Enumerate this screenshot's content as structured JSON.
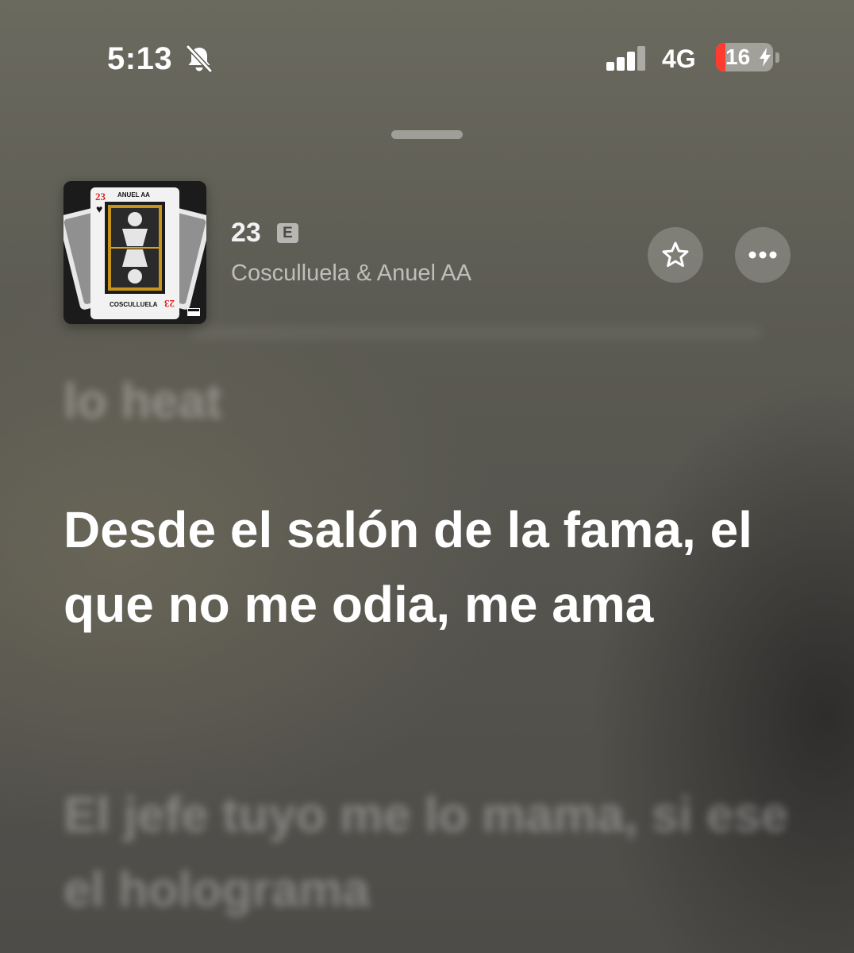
{
  "status_bar": {
    "time": "5:13",
    "network": "4G",
    "battery_level": "16",
    "battery_color": "#ff3b30",
    "icons": [
      "bell-slash-icon",
      "cellular-signal-icon",
      "battery-charging-icon"
    ]
  },
  "now_playing": {
    "title": "23",
    "explicit_label": "E",
    "artist": "Cosculluela & Anuel AA",
    "artwork": {
      "top_text": "ANUEL AA",
      "bottom_text": "COSCULLUELA",
      "number": "23"
    },
    "buttons": {
      "favorite_icon": "star-icon",
      "more_icon": "ellipsis-icon"
    }
  },
  "lyrics": {
    "previous_line": "lo heat",
    "current_line": "Desde el salón de la fama, el que no me odia, me ama",
    "next_line": "El jefe tuyo me lo mama, si ese el holograma"
  }
}
